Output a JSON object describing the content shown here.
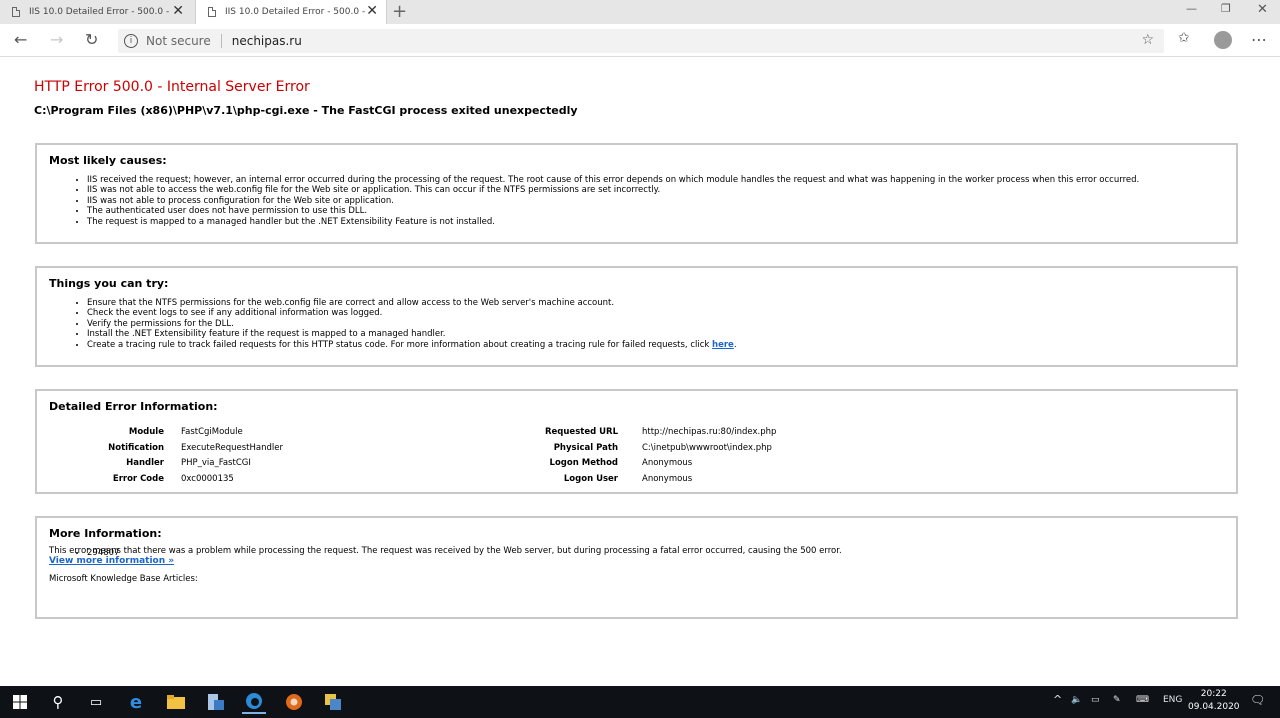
{
  "browser": {
    "tabs": [
      {
        "title": "IIS 10.0 Detailed Error - 500.0 - Internal Server Error",
        "active": false
      },
      {
        "title": "IIS 10.0 Detailed Error - 500.0 - Internal Server Error",
        "active": true
      }
    ],
    "address": {
      "security_label": "Not secure",
      "host": "nechipas.ru"
    }
  },
  "page": {
    "title": "HTTP Error 500.0 - Internal Server Error",
    "subtitle": "C:\\Program Files (x86)\\PHP\\v7.1\\php-cgi.exe - The FastCGI process exited unexpectedly",
    "causes": {
      "heading": "Most likely causes:",
      "items": [
        "IIS received the request; however, an internal error occurred during the processing of the request. The root cause of this error depends on which module handles the request and what was happening in the worker process when this error occurred.",
        "IIS was not able to access the web.config file for the Web site or application. This can occur if the NTFS permissions are set incorrectly.",
        "IIS was not able to process configuration for the Web site or application.",
        "The authenticated user does not have permission to use this DLL.",
        "The request is mapped to a managed handler but the .NET Extensibility Feature is not installed."
      ]
    },
    "try": {
      "heading": "Things you can try:",
      "items": [
        "Ensure that the NTFS permissions for the web.config file are correct and allow access to the Web server's machine account.",
        "Check the event logs to see if any additional information was logged.",
        "Verify the permissions for the DLL.",
        "Install the .NET Extensibility feature if the request is mapped to a managed handler."
      ],
      "last_item_text": "Create a tracing rule to track failed requests for this HTTP status code. For more information about creating a tracing rule for failed requests, click ",
      "last_item_link": "here",
      "last_item_end": "."
    },
    "details": {
      "heading": "Detailed Error Information:",
      "left": [
        {
          "label": "Module",
          "value": "FastCgiModule"
        },
        {
          "label": "Notification",
          "value": "ExecuteRequestHandler"
        },
        {
          "label": "Handler",
          "value": "PHP_via_FastCGI"
        },
        {
          "label": "Error Code",
          "value": "0xc0000135"
        }
      ],
      "right": [
        {
          "label": "Requested URL",
          "value": "http://nechipas.ru:80/index.php"
        },
        {
          "label": "Physical Path",
          "value": "C:\\inetpub\\wwwroot\\index.php"
        },
        {
          "label": "Logon Method",
          "value": "Anonymous"
        },
        {
          "label": "Logon User",
          "value": "Anonymous"
        }
      ]
    },
    "more": {
      "heading": "More Information:",
      "text": "This error means that there was a problem while processing the request. The request was received by the Web server, but during processing a fatal error occurred, causing the 500 error.",
      "link": "View more information »",
      "kb_title": "Microsoft Knowledge Base Articles:",
      "kb_items": [
        "294807"
      ]
    }
  },
  "taskbar": {
    "language": "ENG",
    "time": "20:22",
    "date": "09.04.2020"
  }
}
